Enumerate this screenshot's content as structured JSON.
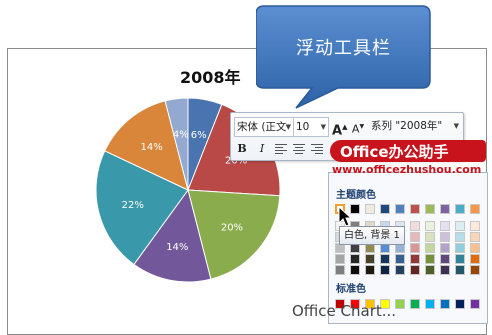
{
  "callout": {
    "text": "浮动工具栏"
  },
  "chart_data": {
    "type": "pie",
    "title": "2008年",
    "values": [
      6,
      20,
      20,
      14,
      22,
      14,
      4
    ],
    "labels": [
      "6%",
      "20%",
      "20%",
      "14%",
      "22%",
      "14%",
      "4%"
    ],
    "colors": [
      "#4a74b0",
      "#b84947",
      "#8aac4c",
      "#72589a",
      "#3a98ab",
      "#d9853a",
      "#93a9cf"
    ]
  },
  "toolbar": {
    "font_name": "宋体 (正文",
    "font_size": "10",
    "grow_font": "A",
    "shrink_font": "A",
    "series_select": "系列 \"2008年\"",
    "bold": "B",
    "italic": "I"
  },
  "watermark": {
    "brand": "Office办公助手",
    "url": "www.officezhushou.com"
  },
  "palette": {
    "theme_header": "主题颜色",
    "standard_header": "标准色",
    "tooltip": "白色, 背景 1",
    "theme_top": [
      "#ffffff",
      "#000000",
      "#eeece1",
      "#1f497d",
      "#4f81bd",
      "#c0504d",
      "#9bbb59",
      "#8064a2",
      "#4bacc6",
      "#f79646"
    ],
    "theme_grid": [
      [
        "#f2f2f2",
        "#7f7f7f",
        "#ddd9c3",
        "#c6d9f0",
        "#dbe5f1",
        "#f2dcdb",
        "#ebf1dd",
        "#e5e0ec",
        "#dbeef3",
        "#fdeada"
      ],
      [
        "#d8d8d8",
        "#595959",
        "#c4bd97",
        "#8db3e2",
        "#b8cce4",
        "#e5b9b7",
        "#d7e3bc",
        "#ccc1d9",
        "#b7dde8",
        "#fbd5b5"
      ],
      [
        "#bfbfbf",
        "#3f3f3f",
        "#938953",
        "#548dd4",
        "#95b3d7",
        "#d99694",
        "#c3d69b",
        "#b2a2c7",
        "#92cddc",
        "#fac08f"
      ],
      [
        "#a5a5a5",
        "#262626",
        "#494429",
        "#17365d",
        "#366092",
        "#953734",
        "#76923c",
        "#5f497a",
        "#31859b",
        "#e36c09"
      ],
      [
        "#7f7f7f",
        "#0c0c0c",
        "#1d1b10",
        "#0f243e",
        "#244061",
        "#632423",
        "#4f6128",
        "#3f3151",
        "#205867",
        "#974806"
      ]
    ],
    "standard": [
      "#c00000",
      "#ff0000",
      "#ffc000",
      "#ffff00",
      "#92d050",
      "#00b050",
      "#00b0f0",
      "#0070c0",
      "#002060",
      "#7030a0"
    ]
  },
  "bottom_text": "Office Chart..."
}
